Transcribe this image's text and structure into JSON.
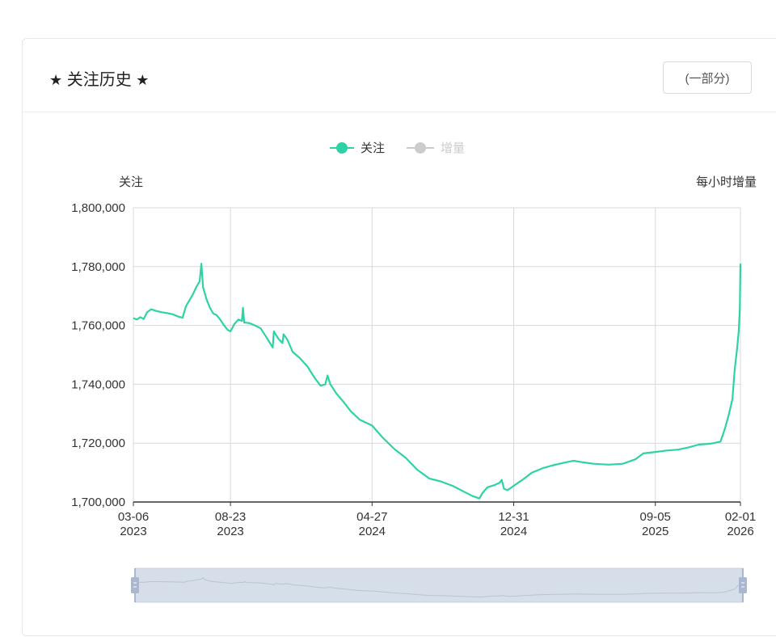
{
  "header": {
    "title": "关注历史",
    "star_left": "★",
    "star_right": "★",
    "range_button": "(一部分)"
  },
  "colors": {
    "series_primary": "#2ed3a5",
    "series_inactive": "#cccccc",
    "grid": "#d8d8d8",
    "zoom_fill": "#d6deea",
    "zoom_handle": "#a9b7cf"
  },
  "chart_data": {
    "type": "line",
    "title": "",
    "y_axis_name": "关注",
    "y2_axis_name": "每小时增量",
    "ylim": [
      1700000,
      1800000
    ],
    "yticks": [
      1700000,
      1720000,
      1740000,
      1760000,
      1780000,
      1800000
    ],
    "ytick_labels": [
      "1,700,000",
      "1,720,000",
      "1,740,000",
      "1,760,000",
      "1,780,000",
      "1,800,000"
    ],
    "xlim": [
      "2023-03-06",
      "2026-02-01"
    ],
    "xticks": [
      {
        "date": "2023-03-06",
        "label1": "03-06",
        "label2": "2023"
      },
      {
        "date": "2023-08-23",
        "label1": "08-23",
        "label2": "2023"
      },
      {
        "date": "2024-04-27",
        "label1": "04-27",
        "label2": "2024"
      },
      {
        "date": "2024-12-31",
        "label1": "12-31",
        "label2": "2024"
      },
      {
        "date": "2025-09-05",
        "label1": "09-05",
        "label2": "2025"
      },
      {
        "date": "2026-02-01",
        "label1": "02-01",
        "label2": "2026"
      }
    ],
    "grid": true,
    "legend_position": "top-center",
    "series": [
      {
        "name": "关注",
        "active": true,
        "points": [
          [
            "2023-03-06",
            1762500
          ],
          [
            "2023-03-12",
            1762000
          ],
          [
            "2023-03-18",
            1762800
          ],
          [
            "2023-03-24",
            1762200
          ],
          [
            "2023-03-30",
            1764500
          ],
          [
            "2023-04-06",
            1765500
          ],
          [
            "2023-04-14",
            1765000
          ],
          [
            "2023-04-24",
            1764500
          ],
          [
            "2023-05-04",
            1764200
          ],
          [
            "2023-05-14",
            1763800
          ],
          [
            "2023-05-24",
            1763000
          ],
          [
            "2023-05-31",
            1762600
          ],
          [
            "2023-06-06",
            1766500
          ],
          [
            "2023-06-12",
            1768500
          ],
          [
            "2023-06-18",
            1770500
          ],
          [
            "2023-06-24",
            1773000
          ],
          [
            "2023-06-30",
            1775000
          ],
          [
            "2023-07-03",
            1781000
          ],
          [
            "2023-07-06",
            1773000
          ],
          [
            "2023-07-12",
            1769000
          ],
          [
            "2023-07-18",
            1766000
          ],
          [
            "2023-07-24",
            1764000
          ],
          [
            "2023-07-30",
            1763500
          ],
          [
            "2023-08-05",
            1762000
          ],
          [
            "2023-08-12",
            1760000
          ],
          [
            "2023-08-18",
            1758500
          ],
          [
            "2023-08-23",
            1758000
          ],
          [
            "2023-08-30",
            1760500
          ],
          [
            "2023-09-06",
            1762000
          ],
          [
            "2023-09-12",
            1761500
          ],
          [
            "2023-09-14",
            1766000
          ],
          [
            "2023-09-16",
            1761000
          ],
          [
            "2023-09-25",
            1760800
          ],
          [
            "2023-10-05",
            1760000
          ],
          [
            "2023-10-15",
            1759000
          ],
          [
            "2023-10-25",
            1756000
          ],
          [
            "2023-11-05",
            1752500
          ],
          [
            "2023-11-07",
            1758000
          ],
          [
            "2023-11-15",
            1755500
          ],
          [
            "2023-11-22",
            1754000
          ],
          [
            "2023-11-24",
            1757000
          ],
          [
            "2023-12-01",
            1755000
          ],
          [
            "2023-12-10",
            1751000
          ],
          [
            "2023-12-22",
            1749000
          ],
          [
            "2024-01-05",
            1746000
          ],
          [
            "2024-01-18",
            1742000
          ],
          [
            "2024-01-28",
            1739500
          ],
          [
            "2024-02-05",
            1740000
          ],
          [
            "2024-02-09",
            1743000
          ],
          [
            "2024-02-14",
            1740000
          ],
          [
            "2024-02-24",
            1737000
          ],
          [
            "2024-03-08",
            1734000
          ],
          [
            "2024-03-20",
            1731000
          ],
          [
            "2024-04-05",
            1728000
          ],
          [
            "2024-04-27",
            1726000
          ],
          [
            "2024-05-15",
            1722000
          ],
          [
            "2024-06-05",
            1718000
          ],
          [
            "2024-06-25",
            1715000
          ],
          [
            "2024-07-15",
            1711000
          ],
          [
            "2024-08-05",
            1708000
          ],
          [
            "2024-08-25",
            1707000
          ],
          [
            "2024-09-15",
            1705500
          ],
          [
            "2024-10-05",
            1703500
          ],
          [
            "2024-10-20",
            1702000
          ],
          [
            "2024-11-01",
            1701200
          ],
          [
            "2024-11-06",
            1703000
          ],
          [
            "2024-11-15",
            1705000
          ],
          [
            "2024-11-28",
            1705800
          ],
          [
            "2024-12-06",
            1706500
          ],
          [
            "2024-12-10",
            1707500
          ],
          [
            "2024-12-14",
            1704500
          ],
          [
            "2024-12-20",
            1704000
          ],
          [
            "2024-12-31",
            1705500
          ],
          [
            "2025-01-15",
            1707500
          ],
          [
            "2025-02-01",
            1710000
          ],
          [
            "2025-02-20",
            1711500
          ],
          [
            "2025-03-10",
            1712500
          ],
          [
            "2025-04-01",
            1713500
          ],
          [
            "2025-04-15",
            1714000
          ],
          [
            "2025-05-01",
            1713500
          ],
          [
            "2025-05-20",
            1713000
          ],
          [
            "2025-06-15",
            1712700
          ],
          [
            "2025-07-10",
            1713000
          ],
          [
            "2025-08-01",
            1714500
          ],
          [
            "2025-08-15",
            1716500
          ],
          [
            "2025-09-05",
            1717000
          ],
          [
            "2025-09-25",
            1717500
          ],
          [
            "2025-10-15",
            1717800
          ],
          [
            "2025-11-01",
            1718500
          ],
          [
            "2025-11-20",
            1719500
          ],
          [
            "2025-12-10",
            1719800
          ],
          [
            "2025-12-28",
            1720500
          ],
          [
            "2026-01-05",
            1725000
          ],
          [
            "2026-01-12",
            1730000
          ],
          [
            "2026-01-18",
            1735000
          ],
          [
            "2026-01-22",
            1745000
          ],
          [
            "2026-01-26",
            1752000
          ],
          [
            "2026-01-29",
            1758000
          ],
          [
            "2026-01-31",
            1766000
          ],
          [
            "2026-02-01",
            1781000
          ]
        ]
      },
      {
        "name": "增量",
        "active": false,
        "points": []
      }
    ]
  },
  "zoom": {
    "start": "2023-03-06",
    "end": "2026-02-01"
  }
}
